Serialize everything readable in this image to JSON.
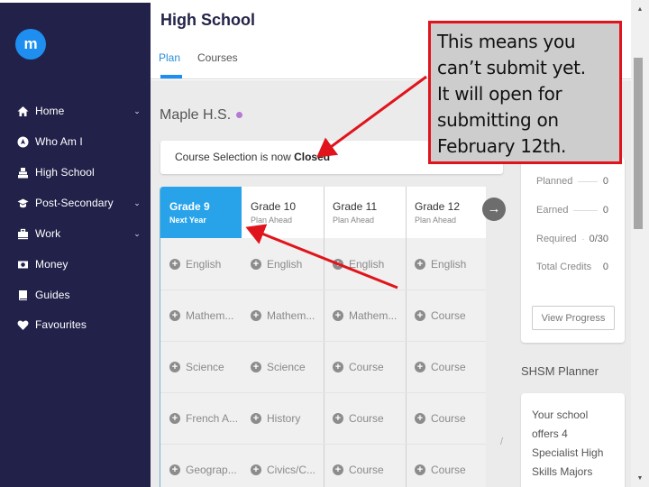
{
  "sidebar": {
    "logo_letter": "m",
    "items": [
      {
        "label": "Home",
        "icon": "home-icon",
        "has_chevron": true
      },
      {
        "label": "Who Am I",
        "icon": "compass-icon",
        "has_chevron": false
      },
      {
        "label": "High School",
        "icon": "school-icon",
        "has_chevron": false
      },
      {
        "label": "Post-Secondary",
        "icon": "graduation-cap-icon",
        "has_chevron": true
      },
      {
        "label": "Work",
        "icon": "briefcase-icon",
        "has_chevron": true
      },
      {
        "label": "Money",
        "icon": "money-icon",
        "has_chevron": false
      },
      {
        "label": "Guides",
        "icon": "book-icon",
        "has_chevron": false
      },
      {
        "label": "Favourites",
        "icon": "heart-icon",
        "has_chevron": false
      }
    ],
    "chevron": "⌄"
  },
  "header": {
    "title": "High School",
    "tabs": [
      {
        "label": "Plan",
        "active": true
      },
      {
        "label": "Courses",
        "active": false
      }
    ]
  },
  "main": {
    "school_name": "Maple H.S.",
    "status_prefix": "Course Selection is now ",
    "status_value": "Closed",
    "grades": [
      {
        "name": "Grade 9",
        "sub": "Next Year",
        "active": true,
        "courses": [
          "English",
          "Mathem...",
          "Science",
          "French A...",
          "Geograp..."
        ]
      },
      {
        "name": "Grade 10",
        "sub": "Plan Ahead",
        "active": false,
        "courses": [
          "English",
          "Mathem...",
          "Science",
          "History",
          "Civics/C..."
        ]
      },
      {
        "name": "Grade 11",
        "sub": "Plan Ahead",
        "active": false,
        "courses": [
          "English",
          "Mathem...",
          "Course",
          "Course",
          "Course"
        ]
      },
      {
        "name": "Grade 12",
        "sub": "Plan Ahead",
        "active": false,
        "courses": [
          "English",
          "Course",
          "Course",
          "Course",
          "Course"
        ]
      }
    ],
    "next_arrow": "→",
    "plus": "+",
    "credits": [
      {
        "label": "Planned",
        "value": "0"
      },
      {
        "label": "Earned",
        "value": "0"
      },
      {
        "label": "Required",
        "value": "0/30"
      },
      {
        "label": "Total Credits",
        "value": "0"
      }
    ],
    "view_progress_label": "View Progress",
    "shsm_title": "SHSM Planner",
    "shsm_text": "Your school offers 4 Specialist High Skills Majors",
    "stray_mark": "/"
  },
  "scrollbar": {
    "up": "▲",
    "down": "▼"
  },
  "annotation": {
    "lines": [
      "This means you",
      "can’t submit yet.",
      "It will open for",
      "submitting on",
      "February 12th."
    ],
    "color": "#e0141c"
  }
}
